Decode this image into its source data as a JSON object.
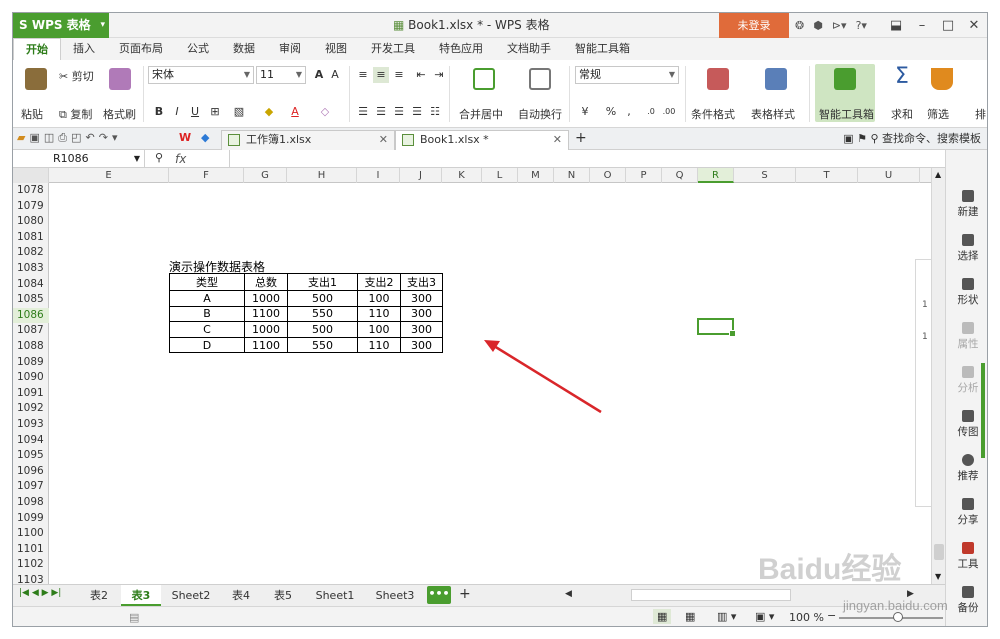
{
  "titlebar": {
    "app_name": "WPS 表格",
    "doc_title": "Book1.xlsx * - WPS 表格",
    "login": "未登录"
  },
  "ribbon_tabs": [
    "开始",
    "插入",
    "页面布局",
    "公式",
    "数据",
    "审阅",
    "视图",
    "开发工具",
    "特色应用",
    "文档助手",
    "智能工具箱"
  ],
  "ribbon": {
    "paste": "粘贴",
    "cut": "剪切",
    "copy": "复制",
    "format_painter": "格式刷",
    "font_name": "宋体",
    "font_size": "11",
    "merge_center": "合并居中",
    "wrap_text": "自动换行",
    "number_format": "常规",
    "conditional_format": "条件格式",
    "table_style": "表格样式",
    "smart_toolbox": "智能工具箱",
    "sum": "求和",
    "filter": "筛选",
    "sort": "排"
  },
  "doc_tabs": {
    "tab1": "工作簿1.xlsx",
    "tab2": "Book1.xlsx *",
    "search": "查找命令、搜索模板"
  },
  "formula_bar": {
    "name_box": "R1086",
    "fx": "fx"
  },
  "grid": {
    "columns": [
      "E",
      "F",
      "G",
      "H",
      "I",
      "J",
      "K",
      "L",
      "M",
      "N",
      "O",
      "P",
      "Q",
      "R",
      "S",
      "T",
      "U"
    ],
    "selected_column": "R",
    "rows": [
      "1078",
      "1079",
      "1080",
      "1081",
      "1082",
      "1083",
      "1084",
      "1085",
      "1086",
      "1087",
      "1088",
      "1089",
      "1090",
      "1091",
      "1092",
      "1093",
      "1094",
      "1095",
      "1096",
      "1097",
      "1098",
      "1099",
      "1100",
      "1101",
      "1102",
      "1103"
    ],
    "selected_row": "1086",
    "table_caption": "演示操作数据表格",
    "table_header": [
      "类型",
      "总数",
      "支出1",
      "支出2",
      "支出3"
    ],
    "table_rows": [
      [
        "A",
        "1000",
        "500",
        "100",
        "300"
      ],
      [
        "B",
        "1100",
        "550",
        "110",
        "300"
      ],
      [
        "C",
        "1000",
        "500",
        "100",
        "300"
      ],
      [
        "D",
        "1100",
        "550",
        "110",
        "300"
      ]
    ],
    "chart_edge_labels": [
      "1",
      "1"
    ]
  },
  "right_pane": [
    {
      "label": "新建",
      "enabled": true
    },
    {
      "label": "选择",
      "enabled": true
    },
    {
      "label": "形状",
      "enabled": true
    },
    {
      "label": "属性",
      "enabled": false
    },
    {
      "label": "分析",
      "enabled": false
    },
    {
      "label": "传图",
      "enabled": true
    },
    {
      "label": "推荐",
      "enabled": true
    },
    {
      "label": "分享",
      "enabled": true
    },
    {
      "label": "工具",
      "enabled": true
    },
    {
      "label": "备份",
      "enabled": true
    }
  ],
  "sheets": {
    "tabs": [
      "表2",
      "表3",
      "Sheet2",
      "表4",
      "表5",
      "Sheet1",
      "Sheet3"
    ],
    "active": "表3",
    "more": "•••",
    "add": "+"
  },
  "status": {
    "zoom": "100 %"
  },
  "watermark": {
    "text": "Baidu经验",
    "url": "jingyan.baidu.com"
  },
  "colors": {
    "accent": "#4a9d2f",
    "login_bg": "#e06b3a",
    "arrow": "#d9262a"
  }
}
